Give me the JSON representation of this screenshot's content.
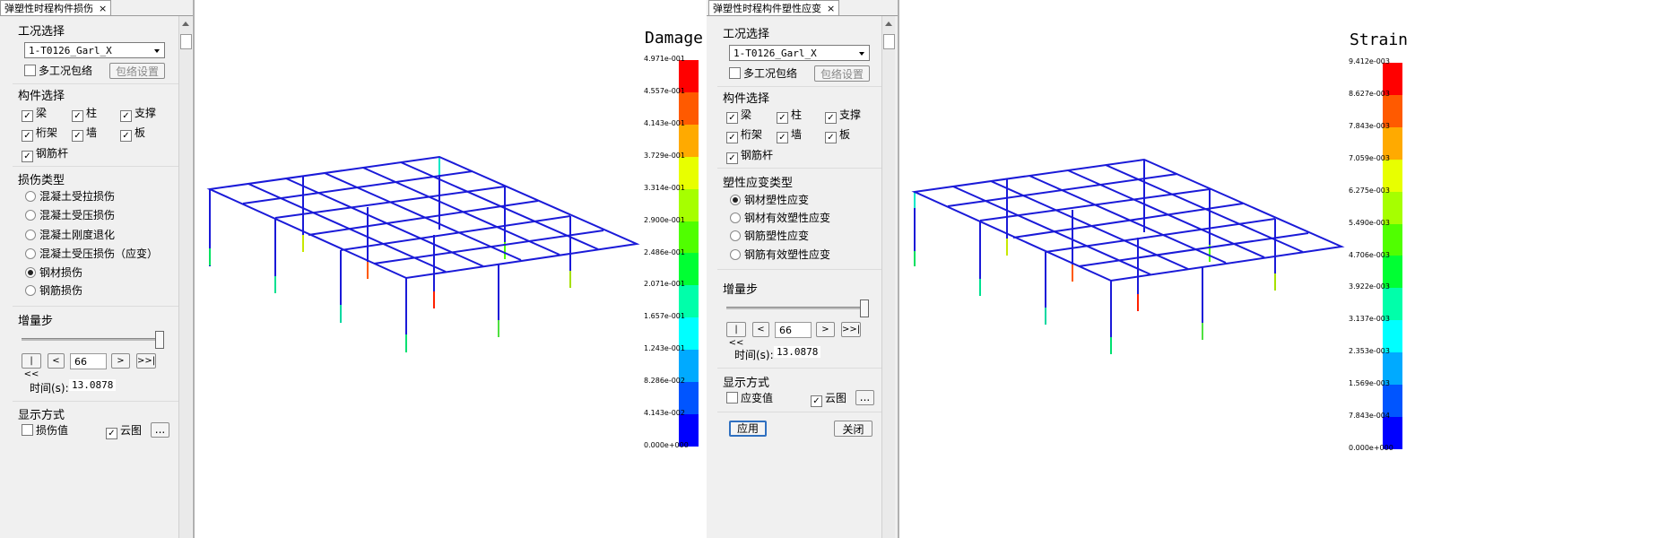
{
  "left_panel": {
    "tab_title": "弹塑性时程构件损伤",
    "close_glyph": "×",
    "case_section": "工况选择",
    "case_value": "1-T0126_Garl_X",
    "multi_case": "多工况包络",
    "envelope_button": "包络设置",
    "member_section": "构件选择",
    "members": [
      {
        "label": "梁",
        "checked": true
      },
      {
        "label": "柱",
        "checked": true
      },
      {
        "label": "支撑",
        "checked": true
      },
      {
        "label": "桁架",
        "checked": true
      },
      {
        "label": "墙",
        "checked": true
      },
      {
        "label": "板",
        "checked": true
      },
      {
        "label": "钢筋杆",
        "checked": true
      }
    ],
    "type_section": "损伤类型",
    "types": [
      {
        "label": "混凝土受拉损伤",
        "selected": false
      },
      {
        "label": "混凝土受压损伤",
        "selected": false
      },
      {
        "label": "混凝土刚度退化",
        "selected": false
      },
      {
        "label": "混凝土受压损伤（应变）",
        "selected": false
      },
      {
        "label": "钢材损伤",
        "selected": true
      },
      {
        "label": "钢筋损伤",
        "selected": false
      }
    ],
    "step_section": "增量步",
    "nav": {
      "first": "|<<",
      "prev": "<",
      "next": ">",
      "last": ">>|"
    },
    "step_value": "66",
    "time_label": "时间(s):",
    "time_value": "13.0878",
    "display_section": "显示方式",
    "display_value": "损伤值",
    "display_cloud": "云图",
    "more_button": "...",
    "check_mark": "✓"
  },
  "right_panel": {
    "tab_title": "弹塑性时程构件塑性应变",
    "close_glyph": "×",
    "case_section": "工况选择",
    "case_value": "1-T0126_Garl_X",
    "multi_case": "多工况包络",
    "envelope_button": "包络设置",
    "member_section": "构件选择",
    "members": [
      {
        "label": "梁",
        "checked": true
      },
      {
        "label": "柱",
        "checked": true
      },
      {
        "label": "支撑",
        "checked": true
      },
      {
        "label": "桁架",
        "checked": true
      },
      {
        "label": "墙",
        "checked": true
      },
      {
        "label": "板",
        "checked": true
      },
      {
        "label": "钢筋杆",
        "checked": true
      }
    ],
    "type_section": "塑性应变类型",
    "types": [
      {
        "label": "钢材塑性应变",
        "selected": true
      },
      {
        "label": "钢材有效塑性应变",
        "selected": false
      },
      {
        "label": "钢筋塑性应变",
        "selected": false
      },
      {
        "label": "钢筋有效塑性应变",
        "selected": false
      }
    ],
    "step_section": "增量步",
    "nav": {
      "first": "|<<",
      "prev": "<",
      "next": ">",
      "last": ">>|"
    },
    "step_value": "66",
    "time_label": "时间(s):",
    "time_value": "13.0878",
    "display_section": "显示方式",
    "display_value": "应变值",
    "display_cloud": "云图",
    "more_button": "...",
    "apply_button": "应用",
    "close_button": "关闭",
    "check_mark": "✓"
  },
  "legend_colors": [
    "#ff0000",
    "#ff5a00",
    "#ffaa00",
    "#e8ff00",
    "#a6ff00",
    "#50ff00",
    "#00ff33",
    "#00ffaa",
    "#00ffff",
    "#00aaff",
    "#0055ff",
    "#0000ff"
  ],
  "damage_legend": {
    "title": "Damage",
    "ticks": [
      "4.971e-001",
      "4.557e-001",
      "4.143e-001",
      "3.729e-001",
      "3.314e-001",
      "2.900e-001",
      "2.486e-001",
      "2.071e-001",
      "1.657e-001",
      "1.243e-001",
      "8.286e-002",
      "4.143e-002",
      "0.000e+000"
    ]
  },
  "strain_legend": {
    "title": "Strain",
    "ticks": [
      "9.412e-003",
      "8.627e-003",
      "7.843e-003",
      "7.059e-003",
      "6.275e-003",
      "5.490e-003",
      "4.706e-003",
      "3.922e-003",
      "3.137e-003",
      "2.353e-003",
      "1.569e-003",
      "7.843e-004",
      "0.000e+000"
    ]
  },
  "frame_color": "#1a1ad8"
}
